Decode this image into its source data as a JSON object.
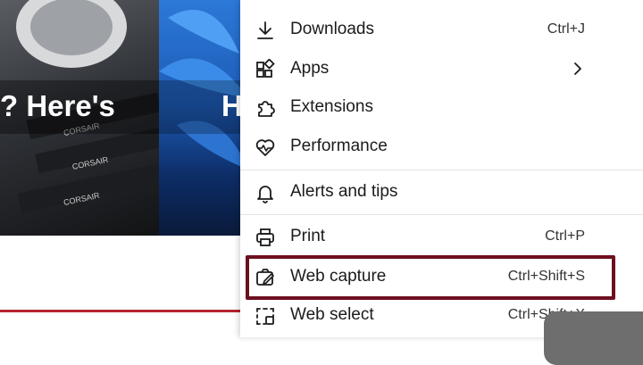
{
  "hero": {
    "left_text": "? Here's",
    "right_text": "H",
    "label_corsair_1": "CORSAIR",
    "label_corsair_2": "CORSAIR",
    "label_corsair_3": "CORSAIR"
  },
  "menu": {
    "items": [
      {
        "label": "Downloads",
        "shortcut": "Ctrl+J",
        "icon": "download-icon"
      },
      {
        "label": "Apps",
        "shortcut": "",
        "icon": "apps-icon",
        "has_submenu": true
      },
      {
        "label": "Extensions",
        "shortcut": "",
        "icon": "extensions-icon"
      },
      {
        "label": "Performance",
        "shortcut": "",
        "icon": "performance-icon"
      },
      {
        "label": "Alerts and tips",
        "shortcut": "",
        "icon": "bell-icon"
      },
      {
        "label": "Print",
        "shortcut": "Ctrl+P",
        "icon": "print-icon"
      },
      {
        "label": "Web capture",
        "shortcut": "Ctrl+Shift+S",
        "icon": "web-capture-icon"
      },
      {
        "label": "Web select",
        "shortcut": "Ctrl+Shift+X",
        "icon": "web-select-icon"
      }
    ]
  },
  "colors": {
    "highlight_border": "#6d0f1f",
    "accent_red": "#b5232f"
  }
}
